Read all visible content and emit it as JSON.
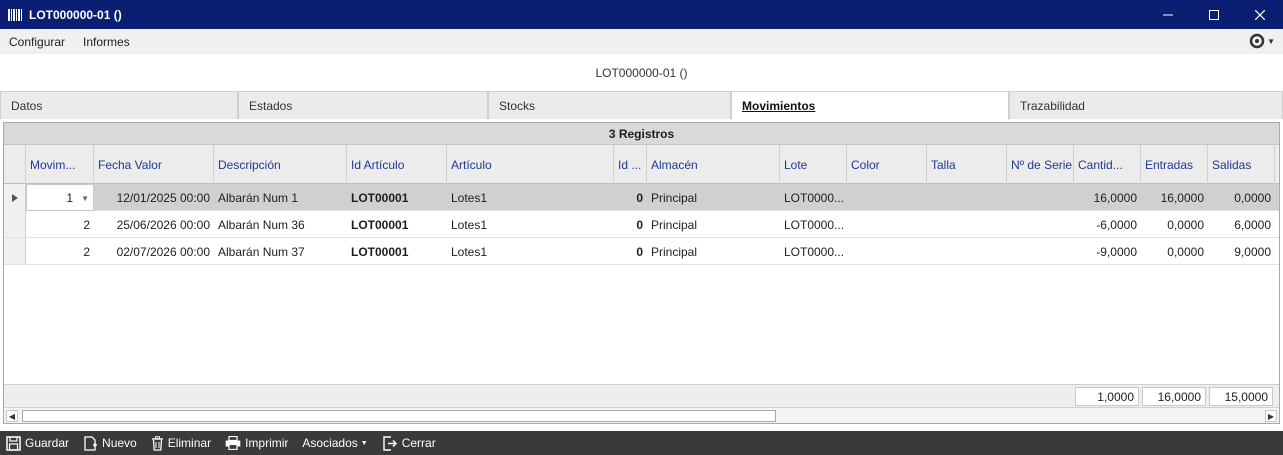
{
  "window": {
    "title": "LOT000000-01 ()"
  },
  "menu": {
    "configurar": "Configurar",
    "informes": "Informes"
  },
  "document": {
    "title": "LOT000000-01 ()"
  },
  "tabs": [
    {
      "label": "Datos"
    },
    {
      "label": "Estados"
    },
    {
      "label": "Stocks"
    },
    {
      "label": "Movimientos"
    },
    {
      "label": "Trazabilidad"
    }
  ],
  "grid": {
    "record_count": "3 Registros",
    "columns": [
      "Movim...",
      "Fecha Valor",
      "Descripción",
      "Id Artículo",
      "Artículo",
      "Id ...",
      "Almacén",
      "Lote",
      "Color",
      "Talla",
      "Nº de Serie",
      "Cantid...",
      "Entradas",
      "Salidas"
    ],
    "rows": [
      {
        "mov": "1",
        "fecha": "12/01/2025 00:00",
        "desc": "Albarán Num 1",
        "id_art": "LOT00001",
        "art": "Lotes1",
        "id": "0",
        "almacen": "Principal",
        "lote": "LOT0000...",
        "color": "",
        "talla": "",
        "serie": "",
        "cant": "16,0000",
        "entradas": "16,0000",
        "salidas": "0,0000"
      },
      {
        "mov": "2",
        "fecha": "25/06/2026 00:00",
        "desc": "Albarán Num 36",
        "id_art": "LOT00001",
        "art": "Lotes1",
        "id": "0",
        "almacen": "Principal",
        "lote": "LOT0000...",
        "color": "",
        "talla": "",
        "serie": "",
        "cant": "-6,0000",
        "entradas": "0,0000",
        "salidas": "6,0000"
      },
      {
        "mov": "2",
        "fecha": "02/07/2026 00:00",
        "desc": "Albarán Num 37",
        "id_art": "LOT00001",
        "art": "Lotes1",
        "id": "0",
        "almacen": "Principal",
        "lote": "LOT0000...",
        "color": "",
        "talla": "",
        "serie": "",
        "cant": "-9,0000",
        "entradas": "0,0000",
        "salidas": "9,0000"
      }
    ],
    "totals": {
      "cant": "1,0000",
      "entradas": "16,0000",
      "salidas": "15,0000"
    }
  },
  "toolbar": {
    "guardar": "Guardar",
    "nuevo": "Nuevo",
    "eliminar": "Eliminar",
    "imprimir": "Imprimir",
    "asociados": "Asociados",
    "cerrar": "Cerrar"
  },
  "colors": {
    "titlebar": "#0a1f73",
    "header_text": "#1f3a93",
    "toolbar": "#3a3a3a"
  }
}
